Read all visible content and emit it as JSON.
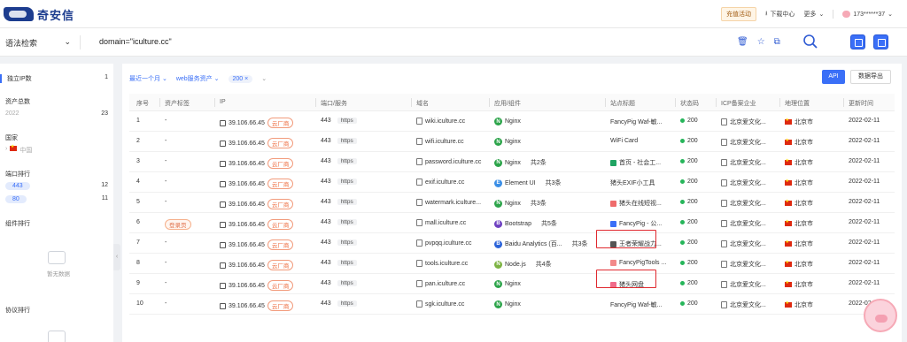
{
  "header": {
    "brand": "奇安信",
    "notice_btn": "充值活动",
    "download": "下载中心",
    "more": "更多",
    "user": "173******37"
  },
  "search": {
    "mode": "语法检索",
    "query": "domain=\"iculture.cc\""
  },
  "sidebar": {
    "ip_count_label": "独立IP数",
    "ip_count_value": "1",
    "asset_total_label": "资产总数",
    "asset_year": "2022",
    "asset_year_value": "23",
    "country_label": "国家",
    "country_value": "中国",
    "port_rank_label": "端口排行",
    "ports": [
      {
        "port": "443",
        "count": "12"
      },
      {
        "port": "80",
        "count": "11"
      }
    ],
    "component_rank_label": "组件排行",
    "empty_text": "暂无数据",
    "protocol_rank_label": "协议排行",
    "collapse_arrow": "‹"
  },
  "filters": {
    "time": "最近一个月",
    "service": "web服务资产",
    "status_chip": "200",
    "api_button": "API",
    "export_button": "数据导出"
  },
  "table": {
    "columns": [
      "序号",
      "资产标签",
      "IP",
      "端口/服务",
      "域名",
      "应用/组件",
      "站点标题",
      "状态码",
      "ICP备案企业",
      "地理位置",
      "更新时间"
    ],
    "rows": [
      {
        "no": "1",
        "tag": "-",
        "ip": "39.106.66.45",
        "cloud": "云厂商",
        "port": "443",
        "svc": "https",
        "domain": "wiki.iculture.cc",
        "app": "Nginx",
        "app_more": "",
        "title": "FancyPig Waf-敏...",
        "status": "200",
        "icp": "北京爱文化...",
        "geo": "北京市",
        "date": "2022-02-11"
      },
      {
        "no": "2",
        "tag": "-",
        "ip": "39.106.66.45",
        "cloud": "云厂商",
        "port": "443",
        "svc": "https",
        "domain": "wifi.iculture.cc",
        "app": "Nginx",
        "app_more": "",
        "title": "WiFi Card",
        "status": "200",
        "icp": "北京爱文化...",
        "geo": "北京市",
        "date": "2022-02-11"
      },
      {
        "no": "3",
        "tag": "-",
        "ip": "39.106.66.45",
        "cloud": "云厂商",
        "port": "443",
        "svc": "https",
        "domain": "password.iculture.cc",
        "app": "Nginx",
        "app_more": "共2条",
        "title": "首页 - 社会工...",
        "status": "200",
        "icp": "北京爱文化...",
        "geo": "北京市",
        "date": "2022-02-11"
      },
      {
        "no": "4",
        "tag": "-",
        "ip": "39.106.66.45",
        "cloud": "云厂商",
        "port": "443",
        "svc": "https",
        "domain": "exif.iculture.cc",
        "app": "Element UI",
        "app_more": "共3条",
        "title": "猪头EXIF小工具",
        "status": "200",
        "icp": "北京爱文化...",
        "geo": "北京市",
        "date": "2022-02-11"
      },
      {
        "no": "5",
        "tag": "-",
        "ip": "39.106.66.45",
        "cloud": "云厂商",
        "port": "443",
        "svc": "https",
        "domain": "watermark.iculture...",
        "app": "Nginx",
        "app_more": "共3条",
        "title": "猪头在线短视...",
        "status": "200",
        "icp": "北京爱文化...",
        "geo": "北京市",
        "date": "2022-02-11"
      },
      {
        "no": "6",
        "tag": "登录页",
        "ip": "39.106.66.45",
        "cloud": "云厂商",
        "port": "443",
        "svc": "https",
        "domain": "mall.iculture.cc",
        "app": "Bootstrap",
        "app_more": "共5条",
        "title": "FancyPig - 公...",
        "status": "200",
        "icp": "北京爱文化...",
        "geo": "北京市",
        "date": "2022-02-11"
      },
      {
        "no": "7",
        "tag": "-",
        "ip": "39.106.66.45",
        "cloud": "云厂商",
        "port": "443",
        "svc": "https",
        "domain": "pvpqq.iculture.cc",
        "app": "Baidu Analytics (百...",
        "app_more": "共3条",
        "title": "王者荣耀战力...",
        "status": "200",
        "icp": "北京爱文化...",
        "geo": "北京市",
        "date": "2022-02-11"
      },
      {
        "no": "8",
        "tag": "-",
        "ip": "39.106.66.45",
        "cloud": "云厂商",
        "port": "443",
        "svc": "https",
        "domain": "tools.iculture.cc",
        "app": "Node.js",
        "app_more": "共4条",
        "title": "FancyPigTools ...",
        "status": "200",
        "icp": "北京爱文化...",
        "geo": "北京市",
        "date": "2022-02-11"
      },
      {
        "no": "9",
        "tag": "-",
        "ip": "39.106.66.45",
        "cloud": "云厂商",
        "port": "443",
        "svc": "https",
        "domain": "pan.iculture.cc",
        "app": "Nginx",
        "app_more": "",
        "title": "猪头网盘",
        "status": "200",
        "icp": "北京爱文化...",
        "geo": "北京市",
        "date": "2022-02-11"
      },
      {
        "no": "10",
        "tag": "-",
        "ip": "39.106.66.45",
        "cloud": "云厂商",
        "port": "443",
        "svc": "https",
        "domain": "sgk.iculture.cc",
        "app": "Nginx",
        "app_more": "",
        "title": "FancyPig Waf-敏...",
        "status": "200",
        "icp": "北京爱文化...",
        "geo": "北京市",
        "date": "2022-02-11"
      }
    ]
  },
  "colors": {
    "accent": "#3a6ff7",
    "ok": "#26b55a",
    "highlight": "#e0292f"
  }
}
